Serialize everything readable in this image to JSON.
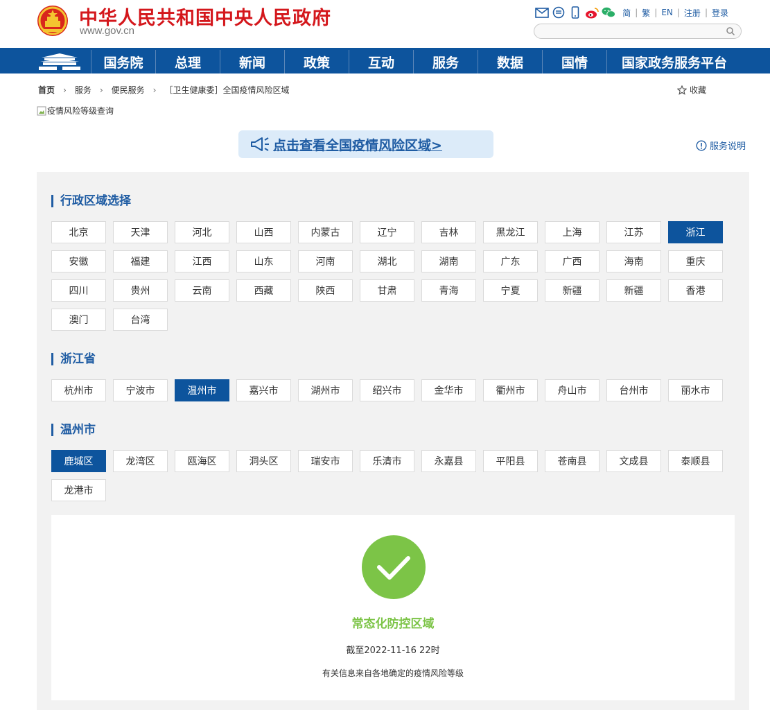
{
  "site": {
    "title": "中华人民共和国中央人民政府",
    "domain": "www.gov.cn"
  },
  "top_links": [
    "简",
    "繁",
    "EN",
    "注册",
    "登录"
  ],
  "search": {
    "placeholder": ""
  },
  "nav": [
    "国务院",
    "总理",
    "新闻",
    "政策",
    "互动",
    "服务",
    "数据",
    "国情",
    "国家政务服务平台"
  ],
  "breadcrumb": [
    "首页",
    "服务",
    "便民服务",
    "［卫生健康委］全国疫情风险区域"
  ],
  "favorite_label": "收藏",
  "broken_image_alt": "疫情风险等级查询",
  "banner_text": "点击查看全国疫情风险区域>",
  "service_note_label": "服务说明",
  "sections": {
    "region_title": "行政区域选择",
    "province_title": "浙江省",
    "city_title": "温州市"
  },
  "provinces": [
    "北京",
    "天津",
    "河北",
    "山西",
    "内蒙古",
    "辽宁",
    "吉林",
    "黑龙江",
    "上海",
    "江苏",
    "浙江",
    "安徽",
    "福建",
    "江西",
    "山东",
    "河南",
    "湖北",
    "湖南",
    "广东",
    "广西",
    "海南",
    "重庆",
    "四川",
    "贵州",
    "云南",
    "西藏",
    "陕西",
    "甘肃",
    "青海",
    "宁夏",
    "新疆",
    "新疆",
    "香港",
    "澳门",
    "台湾"
  ],
  "selected_province": "浙江",
  "cities": [
    "杭州市",
    "宁波市",
    "温州市",
    "嘉兴市",
    "湖州市",
    "绍兴市",
    "金华市",
    "衢州市",
    "舟山市",
    "台州市",
    "丽水市"
  ],
  "selected_city": "温州市",
  "districts": [
    "鹿城区",
    "龙湾区",
    "瓯海区",
    "洞头区",
    "瑞安市",
    "乐清市",
    "永嘉县",
    "平阳县",
    "苍南县",
    "文成县",
    "泰顺县",
    "龙港市"
  ],
  "selected_district": "鹿城区",
  "result": {
    "level": "常态化防控区域",
    "as_of": "截至2022-11-16 22时",
    "note": "有关信息来自各地确定的疫情风险等级"
  },
  "colors": {
    "brand_red": "#d4171c",
    "nav_blue": "#0d549d",
    "link_blue": "#1f5ca3",
    "safe_green": "#7cc447"
  }
}
